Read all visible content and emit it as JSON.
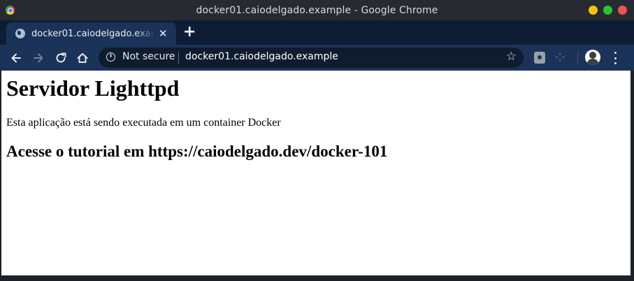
{
  "window": {
    "title": "docker01.caiodelgado.example - Google Chrome",
    "controls": [
      {
        "name": "minimize",
        "color": "#f5c211"
      },
      {
        "name": "maximize",
        "color": "#2dc236"
      },
      {
        "name": "close",
        "color": "#ed5353"
      }
    ]
  },
  "tab": {
    "title": "docker01.caiodelgado.example",
    "close_glyph": "✕",
    "favicon": "globe-icon"
  },
  "new_tab": {
    "glyph": "+"
  },
  "nav": {
    "back_icon": "arrow-left-icon",
    "forward_icon": "arrow-right-icon",
    "reload_icon": "reload-icon",
    "home_icon": "home-icon"
  },
  "omnibox": {
    "security_label": "Not secure",
    "url": "docker01.caiodelgado.example",
    "star_glyph": "☆"
  },
  "toolbar": {
    "extension_icons": [
      "extension-icon",
      "extension-puzzle-icon"
    ],
    "ext2_glyph": "⁘",
    "profile_icon": "avatar"
  },
  "page": {
    "heading": "Servidor Lighttpd",
    "paragraph": "Esta aplicação está sendo executada em um container Docker",
    "subheading": "Acesse o tutorial em https://caiodelgado.dev/docker-101"
  },
  "colors": {
    "titlebar": "#272b31",
    "tabstrip": "#0e1d36",
    "toolbar": "#1b3358",
    "omnibox": "#0f1b2e",
    "page_bg": "#ffffff"
  }
}
